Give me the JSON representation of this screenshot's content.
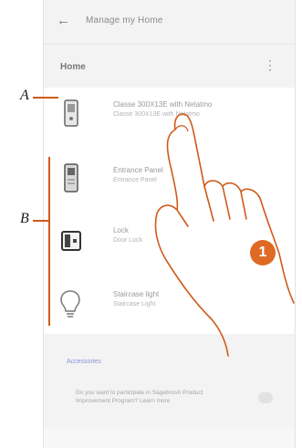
{
  "header": {
    "back_icon": "arrow-left-icon",
    "title": "Manage my Home"
  },
  "home": {
    "label": "Home",
    "menu_icon": "kebab-menu-icon"
  },
  "devices": [
    {
      "icon": "door-entry-unit-icon",
      "name": "Classe 300X13E with Netatmo",
      "subtitle": "Classe 300X13E with Netatmo"
    },
    {
      "icon": "external-unit-icon",
      "name": "Entrance Panel",
      "subtitle": "Entrance Panel"
    },
    {
      "icon": "lock-icon",
      "name": "Lock",
      "subtitle": "Door Lock"
    },
    {
      "icon": "light-bulb-icon",
      "name": "Staircase light",
      "subtitle": "Staircase Light"
    }
  ],
  "more_link": "Accessories",
  "footer": {
    "text": "Do you want to participate in Sagebrush Product Improvement Program? Learn more",
    "toggle_icon": "toggle-icon"
  },
  "callouts": {
    "a": "A",
    "b": "B",
    "step": "1"
  },
  "colors": {
    "accent": "#de6a25",
    "link": "#8b8fd8"
  }
}
